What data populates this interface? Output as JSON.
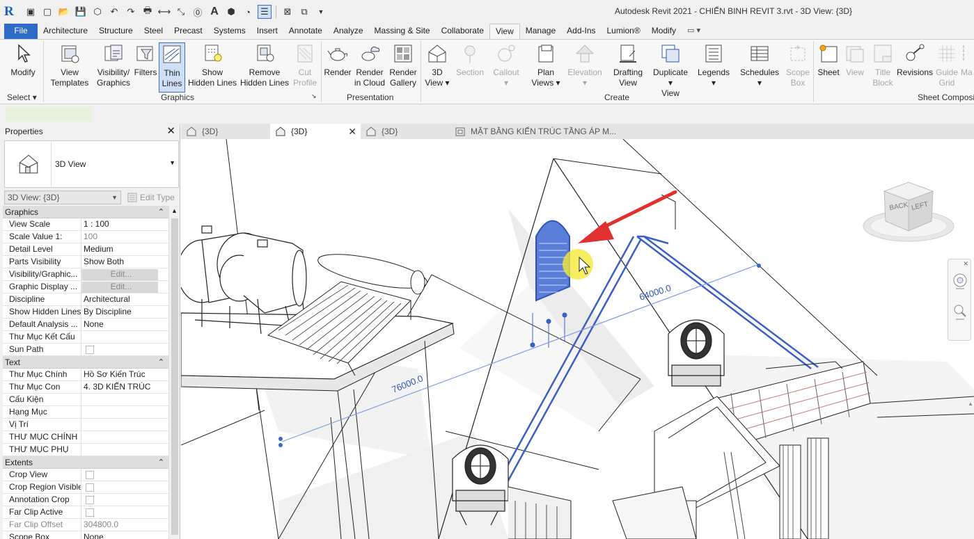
{
  "app": {
    "logo": "R",
    "title": "Autodesk Revit 2021 - CHIẾN BINH REVIT 3.rvt - 3D View: {3D}"
  },
  "qat": [
    "open-icon",
    "new-icon",
    "save-icon",
    "sync-icon",
    "undo-icon",
    "redo-icon",
    "print-icon",
    "measure-icon",
    "dimension-icon",
    "tag-icon",
    "text-icon",
    "3d-view-icon",
    "section-icon",
    "thin-lines-icon",
    "close-hidden-icon",
    "switch-windows-icon",
    "customize-icon"
  ],
  "menu": {
    "tabs": [
      "File",
      "Architecture",
      "Structure",
      "Steel",
      "Precast",
      "Systems",
      "Insert",
      "Annotate",
      "Analyze",
      "Massing & Site",
      "Collaborate",
      "View",
      "Manage",
      "Add-Ins",
      "Lumion®",
      "Modify"
    ],
    "active": "View"
  },
  "ribbon": {
    "modify": "Modify",
    "select": "Select",
    "view_templates_1": "View",
    "view_templates_2": "Templates",
    "visibility_1": "Visibility/",
    "visibility_2": "Graphics",
    "filters": "Filters",
    "thin_1": "Thin",
    "thin_2": "Lines",
    "show_hidden_1": "Show",
    "show_hidden_2": "Hidden Lines",
    "remove_hidden_1": "Remove",
    "remove_hidden_2": "Hidden Lines",
    "cut_profile_1": "Cut",
    "cut_profile_2": "Profile",
    "graphics_label": "Graphics",
    "render": "Render",
    "render_cloud_1": "Render",
    "render_cloud_2": "in Cloud",
    "render_gallery_1": "Render",
    "render_gallery_2": "Gallery",
    "presentation_label": "Presentation",
    "view3d_1": "3D",
    "view3d_2": "View",
    "section": "Section",
    "callout": "Callout",
    "plan_1": "Plan",
    "plan_2": "Views",
    "elevation": "Elevation",
    "drafting_1": "Drafting",
    "drafting_2": "View",
    "duplicate_1": "Duplicate",
    "duplicate_2": "View",
    "legends": "Legends",
    "schedules": "Schedules",
    "scope_1": "Scope",
    "scope_2": "Box",
    "create_label": "Create",
    "sheet": "Sheet",
    "view": "View",
    "title_1": "Title",
    "title_2": "Block",
    "revisions": "Revisions",
    "guide_1": "Guide",
    "guide_2": "Grid",
    "matchline_1": "Ma",
    "sheet_comp_label": "Sheet Composi"
  },
  "properties": {
    "title": "Properties",
    "type_name": "3D View",
    "selector": "3D View: {3D}",
    "edit_type": "Edit Type",
    "groups": [
      {
        "name": "Graphics",
        "rows": [
          {
            "k": "View Scale",
            "v": "1 : 100"
          },
          {
            "k": "Scale Value    1:",
            "v": "100",
            "dim": true
          },
          {
            "k": "Detail Level",
            "v": "Medium"
          },
          {
            "k": "Parts Visibility",
            "v": "Show Both"
          },
          {
            "k": "Visibility/Graphic...",
            "v": "Edit...",
            "btn": true
          },
          {
            "k": "Graphic Display ...",
            "v": "Edit...",
            "btn": true
          },
          {
            "k": "Discipline",
            "v": "Architectural"
          },
          {
            "k": "Show Hidden Lines",
            "v": "By Discipline"
          },
          {
            "k": "Default Analysis ...",
            "v": "None"
          },
          {
            "k": "Thư Mục Kết Cấu",
            "v": ""
          },
          {
            "k": "Sun Path",
            "v": "",
            "cb": true
          }
        ]
      },
      {
        "name": "Text",
        "rows": [
          {
            "k": "Thư Mục Chính",
            "v": "Hồ Sơ Kiến Trúc"
          },
          {
            "k": "Thư Mục Con",
            "v": "4. 3D KIẾN TRÚC"
          },
          {
            "k": "Cấu Kiện",
            "v": ""
          },
          {
            "k": "Hạng Mục",
            "v": ""
          },
          {
            "k": "Vị Trí",
            "v": ""
          },
          {
            "k": "THƯ MỤC CHÍNH",
            "v": ""
          },
          {
            "k": "THƯ MỤC PHỤ",
            "v": ""
          }
        ]
      },
      {
        "name": "Extents",
        "rows": [
          {
            "k": "Crop View",
            "v": "",
            "cb": true
          },
          {
            "k": "Crop Region Visible",
            "v": "",
            "cb": true
          },
          {
            "k": "Annotation Crop",
            "v": "",
            "cb": true
          },
          {
            "k": "Far Clip Active",
            "v": "",
            "cb": true
          },
          {
            "k": "Far Clip Offset",
            "v": "304800.0",
            "dim": true,
            "kdim": true
          },
          {
            "k": "Scope Box",
            "v": "None"
          }
        ]
      }
    ]
  },
  "view_tabs": [
    {
      "label": "{3D}",
      "active": false
    },
    {
      "label": "{3D}",
      "active": true
    },
    {
      "label": "{3D}",
      "active": false
    },
    {
      "label": "MẶT BẰNG KIẾN TRÚC TẦNG ÁP M...",
      "active": false
    }
  ],
  "canvas": {
    "dim_left": "76000.0",
    "dim_right": "64000.0",
    "viewcube_back": "BACK",
    "viewcube_left": "LEFT"
  },
  "colors": {
    "accent": "#2e6bc6",
    "selection": "#2f52b8",
    "arrow": "#e03030",
    "cursor_highlight": "#f5e93a"
  }
}
